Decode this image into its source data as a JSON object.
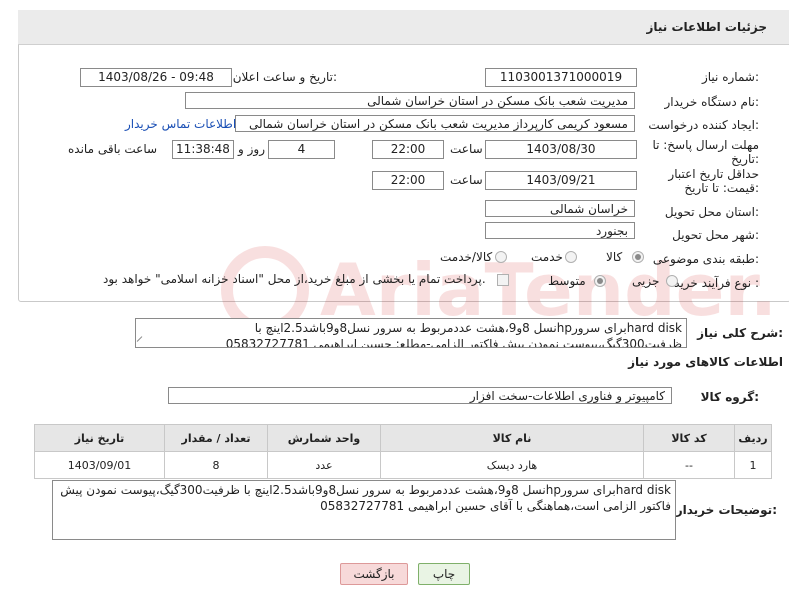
{
  "header": {
    "title": "جزئیات اطلاعات نیاز"
  },
  "fields": {
    "need_number": {
      "label": "شماره نیاز:",
      "value": "1103001371000019"
    },
    "announce_datetime": {
      "label": "تاریخ و ساعت اعلان عمومی:",
      "value": "1403/08/26 - 09:48"
    },
    "buyer_org": {
      "label": "نام دستگاه خریدار:",
      "value": "مدیریت شعب بانک مسکن در استان خراسان شمالی"
    },
    "requester": {
      "label": "ایجاد کننده درخواست:",
      "value": "مسعود کریمی کارپرداز مدیریت شعب بانک مسکن در استان خراسان شمالی"
    },
    "buyer_contact_link": "اطلاعات تماس خریدار",
    "reply_deadline": {
      "label": "مهلت ارسال پاسخ: تا تاریخ:",
      "date": "1403/08/30",
      "time_label": "ساعت",
      "time": "22:00",
      "days": "4",
      "days_label": "روز و",
      "remaining": "11:38:48",
      "remaining_label": "ساعت باقی مانده"
    },
    "price_validity": {
      "label": "حداقل تاریخ اعتبار قیمت: تا تاریخ:",
      "date": "1403/09/21",
      "time_label": "ساعت",
      "time": "22:00"
    },
    "delivery_province": {
      "label": "استان محل تحویل:",
      "value": "خراسان شمالی"
    },
    "delivery_city": {
      "label": "شهر محل تحویل:",
      "value": "بجنورد"
    },
    "category": {
      "label": "طبقه بندی موضوعی:",
      "options": [
        "کالا",
        "خدمت",
        "کالا/خدمت"
      ],
      "selected": "کالا"
    },
    "purchase_type": {
      "label": "نوع فرآیند خرید :",
      "options": [
        "جزیی",
        "متوسط"
      ],
      "selected": "متوسط",
      "payment_note": "پرداخت تمام یا بخشی از مبلغ خرید،از محل \"اسناد خزانه اسلامی\" خواهد بود."
    }
  },
  "summary": {
    "label": "شرح کلی نیاز:",
    "text": "hard diskبرای سرورhpنسل 8و9،هشت عددمربوط به سرور نسل8و9باشد2.5اینچ با ظرفیت300گیگ،پیوست نمودن پیش فاکتور الزامی-مطلع: حسین ابراهیمی 05832727781"
  },
  "goods_info_title": "اطلاعات کالاهای مورد نیاز",
  "goods_group": {
    "label": "گروه کالا:",
    "value": "کامپیوتر و فناوری اطلاعات-سخت افزار"
  },
  "table": {
    "headers": [
      "ردیف",
      "کد کالا",
      "نام کالا",
      "واحد شمارش",
      "تعداد / مقدار",
      "تاریخ نیاز"
    ],
    "rows": [
      [
        "1",
        "--",
        "هارد دیسک",
        "عدد",
        "8",
        "1403/09/01"
      ]
    ]
  },
  "buyer_notes": {
    "label": "توضیحات خریدار:",
    "text": "hard diskبرای سرورhpنسل 8و9،هشت عددمربوط به سرور نسل8و9باشد2.5اینچ با ظرفیت300گیگ،پیوست نمودن پیش فاکتور الزامی است،هماهنگی با آقای حسین ابراهیمی 05832727781"
  },
  "buttons": {
    "print": "چاپ",
    "back": "بازگشت"
  },
  "watermark": {
    "text": "AriaTender.neT"
  },
  "colors": {
    "link": "#1a4fb5",
    "back_button_bg": "#f7d9d9",
    "print_button_bg": "#e9f4e4"
  }
}
